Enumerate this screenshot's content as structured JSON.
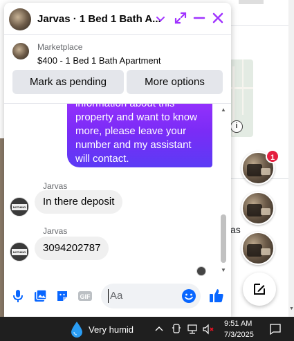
{
  "chat": {
    "title": "Jarvas · 1 Bed 1 Bath A...",
    "listing_source": "Marketplace",
    "listing_title": "$400 - 1 Bed 1 Bath Apartment",
    "mark_pending_label": "Mark as pending",
    "more_options_label": "More options",
    "outgoing_lines": [
      "information about this",
      "property and want to know",
      "more, please leave your",
      "number and my assistant",
      "will contact."
    ],
    "messages": [
      {
        "sender": "Jarvas",
        "text": "In there deposit"
      },
      {
        "sender": "Jarvas",
        "text": "3094202787"
      }
    ],
    "input_placeholder": "Aa",
    "avatar_label": "NOTHING MATTERS"
  },
  "background": {
    "partial_text": "as",
    "unread_badge": "1"
  },
  "taskbar": {
    "weather": "Very humid",
    "time": "9:51 AM",
    "date": "7/3/2025"
  },
  "colors": {
    "accent": "#a033ff",
    "outgoing_gradient_end": "#5b3bf5",
    "messenger_blue": "#0866ff",
    "badge": "#e41e3f"
  }
}
